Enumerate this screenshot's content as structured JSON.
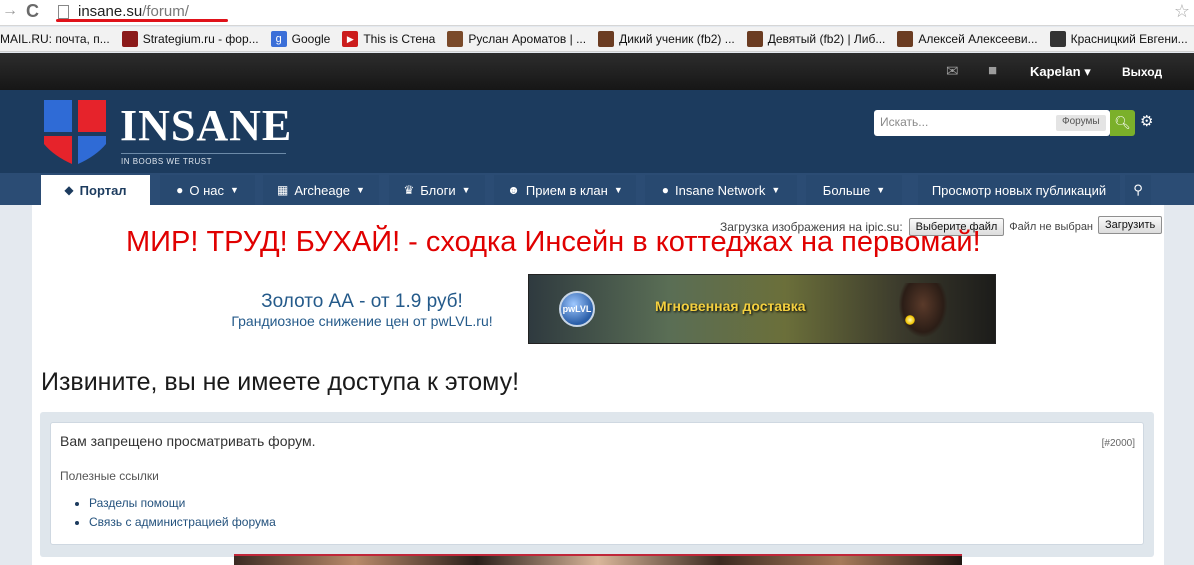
{
  "browser": {
    "url_host": "insane.su",
    "url_path": "/forum/",
    "bookmarks": [
      {
        "label": "MAIL.RU: почта, п...",
        "color": "#ffffff"
      },
      {
        "label": "Strategium.ru - фор...",
        "color": "#8b1a1a"
      },
      {
        "label": "Google",
        "color": "#3b6fd8"
      },
      {
        "label": "This is Стена",
        "color": "#cc1d1d"
      },
      {
        "label": "Руслан Ароматов | ...",
        "color": "#7a4a2a"
      },
      {
        "label": "Дикий ученик (fb2) ...",
        "color": "#6b3c22"
      },
      {
        "label": "Девятый (fb2) | Либ...",
        "color": "#6b3c22"
      },
      {
        "label": "Алексей Алексееви...",
        "color": "#6b3c22"
      },
      {
        "label": "Красницкий Евгени...",
        "color": "#333333"
      }
    ]
  },
  "userbar": {
    "username": "Kapelan",
    "logout": "Выход"
  },
  "header": {
    "logo_text": "INSANE",
    "logo_sub": "IN BOOBS WE TRUST",
    "search_placeholder": "Искать...",
    "search_scope": "Форумы"
  },
  "nav": {
    "tabs": [
      {
        "label": "Портал",
        "icon": "shield-icon"
      },
      {
        "label": "О нас",
        "icon": "globe-icon"
      },
      {
        "label": "Archeage",
        "icon": "grid-icon"
      },
      {
        "label": "Блоги",
        "icon": "trophy-icon"
      },
      {
        "label": "Прием в клан",
        "icon": "people-icon"
      },
      {
        "label": "Insane Network",
        "icon": "globe-icon"
      },
      {
        "label": "Больше",
        "icon": ""
      },
      {
        "label": "Просмотр новых публикаций",
        "icon": ""
      }
    ]
  },
  "upload": {
    "label": "Загрузка изображения на ipic.su:",
    "choose_file": "Выберите файл",
    "no_file": "Файл не выбран",
    "submit": "Загрузить"
  },
  "banner": {
    "title": "МИР! ТРУД! БУХАЙ! - сходка Инсейн в коттеджах на первомай!"
  },
  "ad": {
    "title": "Золото АА - от 1.9 руб!",
    "subtitle": "Грандиозное снижение цен от pwLVL.ru!",
    "banner_text": "Мгновенная доставка",
    "logo_text": "pwLVL"
  },
  "main": {
    "page_title": "Извините, вы не имеете доступа к этому!",
    "error_message": "Вам запрещено просматривать форум.",
    "error_code": "[#2000]",
    "useful_links_title": "Полезные ссылки",
    "links": [
      "Разделы помощи",
      "Связь с администрацией форума"
    ]
  },
  "colors": {
    "header_bg": "#1c3b5e",
    "nav_bg": "#2b4c74",
    "banner_red": "#e00000",
    "search_button": "#7bb02a"
  }
}
